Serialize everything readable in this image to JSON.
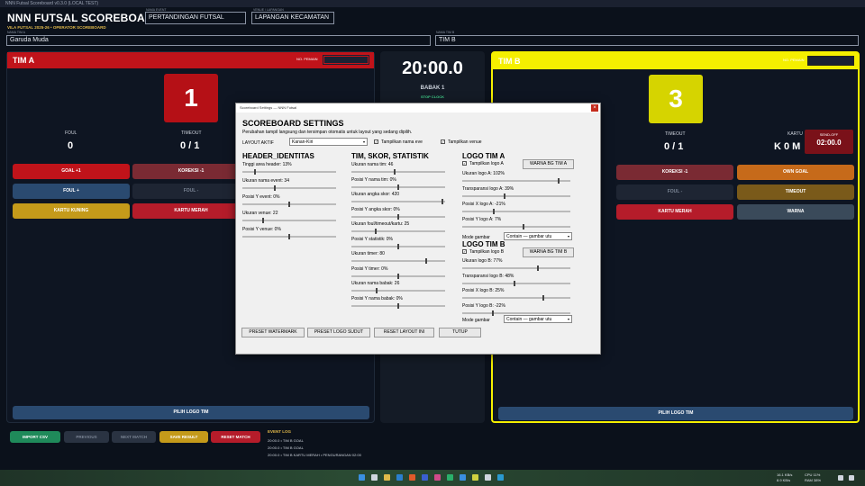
{
  "window": {
    "title": "NNN Futsal Scoreboard v0.3.0 (LOCAL TEST)"
  },
  "app": {
    "name": "NNN FUTSAL SCOREBOARD",
    "subtitle": "VILA FUTSAL 2025-26 • OPERATOR SCOREBOARD"
  },
  "header": {
    "event_label": "NAMA EVENT",
    "event_value": "PERTANDINGAN FUTSAL",
    "venue_label": "VENUE / LAPANGAN",
    "venue_value": "LAPANGAN KECAMATAN",
    "team_a_label": "NAMA TIM A",
    "team_a_value": "Garuda Muda",
    "team_b_label": "NAMA TIM B",
    "team_b_value": "TIM B"
  },
  "team_a": {
    "name": "TIM A",
    "player_label": "NO. PEMAIN",
    "score": "1",
    "foul_label": "FOUL",
    "foul": "0",
    "timeout_label": "TIMEOUT",
    "timeout": "0 / 1",
    "color": "#c0131a",
    "buttons": {
      "goal": "GOAL +1",
      "koreksi": "KOREKSI -1",
      "foul_plus": "FOUL +",
      "foul_minus": "FOUL -",
      "kartu_kuning": "KARTU KUNING",
      "kartu_merah": "KARTU MERAH"
    },
    "pick_logo": "PILIH LOGO TIM"
  },
  "team_b": {
    "name": "TIM B",
    "player_label": "NO. PEMAIN",
    "score": "3",
    "timeout_label": "TIMEOUT",
    "timeout": "0 / 1",
    "kartu_label": "KARTU",
    "kartu": "K 0  M",
    "sendoff_label": "SEND-OFF",
    "sendoff": "02:00.0",
    "color": "#f5ef00",
    "buttons": {
      "koreksi": "KOREKSI -1",
      "own_goal": "OWN GOAL",
      "foul_minus": "FOUL -",
      "timeout": "TIMEOUT",
      "kartu_merah": "KARTU MERAH",
      "warna": "WARNA"
    },
    "pick_logo": "PILIH LOGO TIM"
  },
  "clock": {
    "time": "20:00.0",
    "period": "BABAK 1",
    "status": "STOP CLOCK"
  },
  "footer": {
    "import": "IMPORT CSV",
    "previous": "PREVIOUS",
    "next": "NEXT MATCH",
    "save": "SAVE RESULT",
    "reset": "RESET MATCH",
    "event_log_title": "EVENT LOG",
    "event_log": [
      "20:00.0 • TIM B GOAL",
      "20:00.0 • TIM B GOAL",
      "20:00.0 • TIM B KARTU MERAH • PENGURANGAN 02:00"
    ]
  },
  "dialog": {
    "title": "Scoreboard Settings — NNN Futsal",
    "heading": "SCOREBOARD SETTINGS",
    "subtitle": "Perubahan tampil langsung dan tersimpan otomatis untuk layout yang sedang dipilih.",
    "layout_label": "LAYOUT AKTIF",
    "layout_value": "Kanan-Kiri",
    "show_event": "Tampilkan nama eve",
    "show_venue": "Tampilkan venue",
    "col1": {
      "heading": "HEADER_IDENTITAS",
      "items": [
        {
          "label": "Tinggi area header: 13%",
          "value": 0.13
        },
        {
          "label": "Ukuran nama event: 34",
          "value": 0.34
        },
        {
          "label": "Posisi Y event: 0%",
          "value": 0.5
        },
        {
          "label": "Ukuran venue: 22",
          "value": 0.22
        },
        {
          "label": "Posisi Y venue: 0%",
          "value": 0.5
        }
      ]
    },
    "col2": {
      "heading": "TIM, SKOR, STATISTIK",
      "items": [
        {
          "label": "Ukuran nama tim: 46",
          "value": 0.46
        },
        {
          "label": "Posisi Y nama tim: 0%",
          "value": 0.5
        },
        {
          "label": "Ukuran angka skor: 420",
          "value": 0.98
        },
        {
          "label": "Posisi Y angka skor: 0%",
          "value": 0.5
        },
        {
          "label": "Ukuran foul/timeout/kartu: 25",
          "value": 0.25
        },
        {
          "label": "Posisi Y statistik: 0%",
          "value": 0.5
        },
        {
          "label": "Ukuran timer: 80",
          "value": 0.8
        },
        {
          "label": "Posisi Y timer: 0%",
          "value": 0.5
        },
        {
          "label": "Ukuran nama babak: 26",
          "value": 0.26
        },
        {
          "label": "Posisi Y nama babak: 0%",
          "value": 0.5
        }
      ]
    },
    "col3": {
      "heading_a": "LOGO TIM A",
      "show_a": "Tampilkan logo A",
      "color_a": "WARNA BG TIM A",
      "items_a": [
        {
          "label": "Ukuran logo A: 102%",
          "value": 0.9
        },
        {
          "label": "Transparansi logo A: 39%",
          "value": 0.39
        },
        {
          "label": "Posisi X logo A: -21%",
          "value": 0.29
        },
        {
          "label": "Posisi Y logo A: 7%",
          "value": 0.57
        }
      ],
      "mode_label_a": "Mode gambar",
      "mode_value_a": "Contain — gambar utu",
      "heading_b": "LOGO TIM B",
      "show_b": "Tampilkan logo B",
      "color_b": "WARNA BG TIM B",
      "items_b": [
        {
          "label": "Ukuran logo B: 77%",
          "value": 0.7
        },
        {
          "label": "Transparansi logo B: 48%",
          "value": 0.48
        },
        {
          "label": "Posisi X logo B: 25%",
          "value": 0.75
        },
        {
          "label": "Posisi Y logo B: -22%",
          "value": 0.28
        }
      ],
      "mode_label_b": "Mode gambar",
      "mode_value_b": "Contain — gambar utu"
    },
    "buttons": {
      "preset_wm": "PRESET WATERMARK",
      "preset_logo": "PRESET LOGO SUDUT",
      "reset_layout": "RESET LAYOUT INI",
      "close": "TUTUP"
    }
  },
  "taskbar": {
    "tray_line1": "16.1 KB/s",
    "tray_line2": "8.9 KB/s",
    "cpu": "CPU 11%",
    "ram": "RAM 38%"
  }
}
